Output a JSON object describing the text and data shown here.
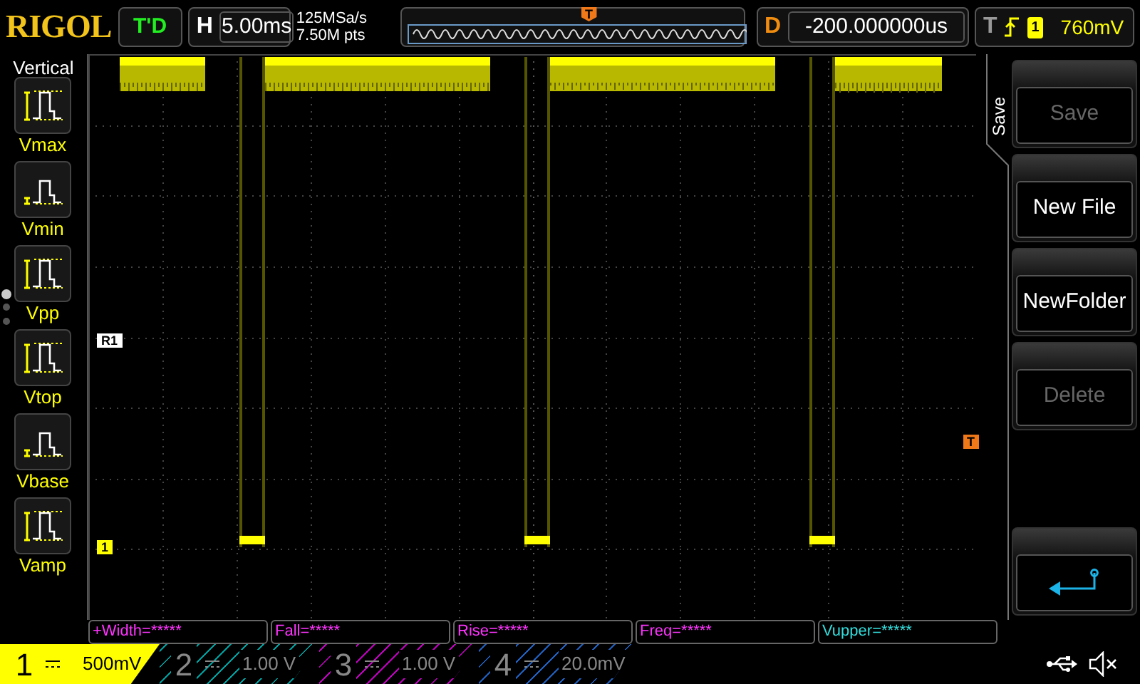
{
  "header": {
    "logo": "RIGOL",
    "run_status": "T'D",
    "timebase": {
      "label": "H",
      "value": "5.00ms"
    },
    "sample_rate": "125MSa/s",
    "memory_depth": "7.50M pts",
    "trigger_position_marker": "T",
    "delay": {
      "label": "D",
      "value": "-200.000000us"
    },
    "trigger": {
      "label": "T",
      "source": "1",
      "level": "760mV"
    }
  },
  "left_menu": {
    "title": "Vertical",
    "items": [
      {
        "label": "Vmax",
        "kind": "max"
      },
      {
        "label": "Vmin",
        "kind": "min"
      },
      {
        "label": "Vpp",
        "kind": "pp"
      },
      {
        "label": "Vtop",
        "kind": "top"
      },
      {
        "label": "Vbase",
        "kind": "base"
      },
      {
        "label": "Vamp",
        "kind": "amp"
      }
    ],
    "pages": [
      {
        "selected": true
      },
      {
        "selected": false
      },
      {
        "selected": false
      }
    ]
  },
  "markers": {
    "reference": "R1",
    "channel": "1",
    "trigger_level": "T"
  },
  "right_menu": {
    "title": "Save",
    "buttons": [
      {
        "label": "Save",
        "disabled": true
      },
      {
        "label": "New File",
        "disabled": false
      },
      {
        "label": "NewFolder",
        "disabled": false
      },
      {
        "label": "Delete",
        "disabled": true
      }
    ]
  },
  "measurements": [
    {
      "text": "+Width=*****",
      "color": "#ff33ff"
    },
    {
      "text": "Fall=*****",
      "color": "#ff33ff"
    },
    {
      "text": "Rise=*****",
      "color": "#ff33ff"
    },
    {
      "text": "Freq=*****",
      "color": "#ff33ff"
    },
    {
      "text": "Vupper=*****",
      "color": "#33dddd"
    }
  ],
  "channels": [
    {
      "number": "1",
      "scale": "500mV",
      "on": true,
      "color": "#ffff00"
    },
    {
      "number": "2",
      "scale": "1.00 V",
      "on": false,
      "color": "#00a0a0"
    },
    {
      "number": "3",
      "scale": "1.00 V",
      "on": false,
      "color": "#c000c0"
    },
    {
      "number": "4",
      "scale": "20.0mV",
      "on": false,
      "color": "#2060c0"
    }
  ]
}
